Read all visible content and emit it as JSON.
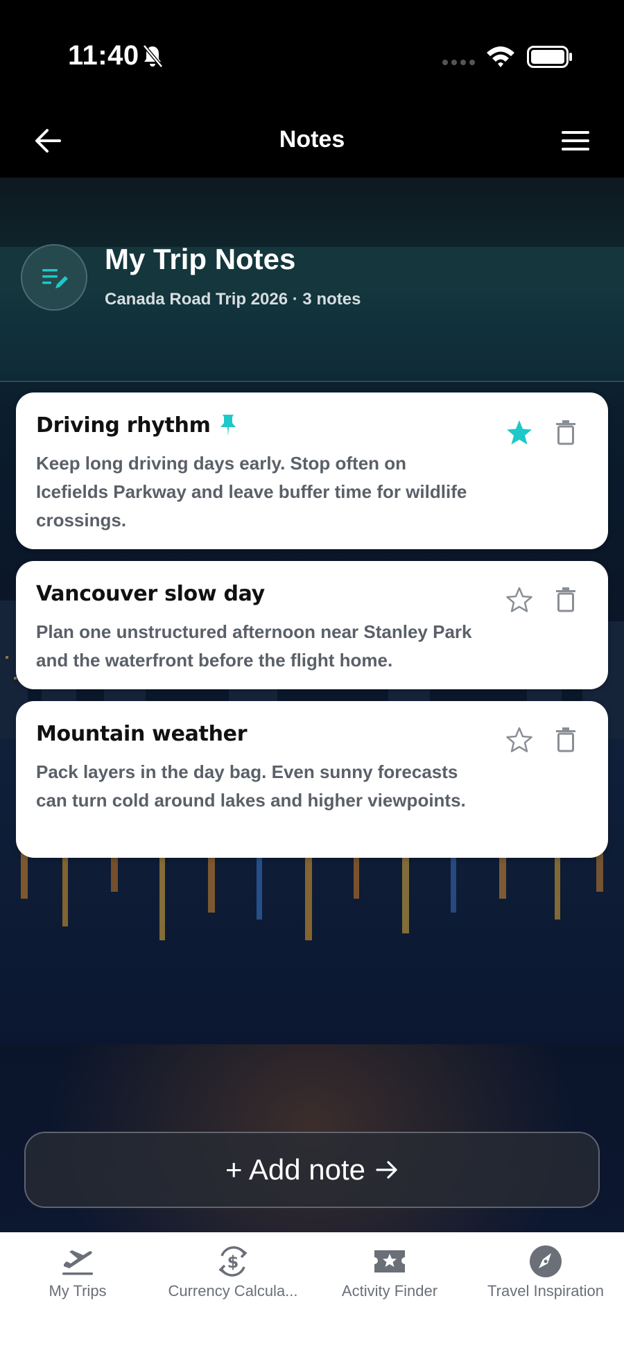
{
  "status_bar": {
    "time": "11:40"
  },
  "app_bar": {
    "title": "Notes"
  },
  "header": {
    "title": "My Trip Notes",
    "subtitle": "Canada Road Trip 2026 · 3 notes"
  },
  "notes": [
    {
      "title": "Driving rhythm",
      "pinned": true,
      "starred": true,
      "body": "Keep long driving days early. Stop often on Icefields Parkway and leave buffer time for wildlife crossings."
    },
    {
      "title": "Vancouver slow day",
      "pinned": false,
      "starred": false,
      "body": "Plan one unstructured afternoon near Stanley Park and the waterfront before the flight home."
    },
    {
      "title": "Mountain weather",
      "pinned": false,
      "starred": false,
      "body": "Pack layers in the day bag. Even sunny forecasts can turn cold around lakes and higher viewpoints."
    }
  ],
  "add_note": {
    "label": "+ Add note"
  },
  "tabs": [
    {
      "label": "My Trips",
      "icon": "airplane-departure-icon"
    },
    {
      "label": "Currency Calcula...",
      "icon": "currency-exchange-icon"
    },
    {
      "label": "Activity Finder",
      "icon": "star-ticket-icon"
    },
    {
      "label": "Travel Inspiration",
      "icon": "compass-icon"
    }
  ],
  "colors": {
    "accent": "#1ec8c8",
    "card_text": "#5a6068",
    "tab_text": "#6a6f78"
  }
}
